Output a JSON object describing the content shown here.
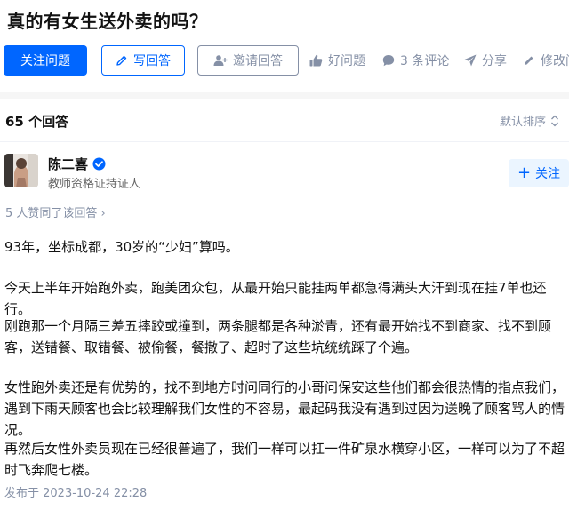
{
  "question": {
    "title": "真的有女生送外卖的吗？"
  },
  "actions": {
    "follow_question": "关注问题",
    "write_answer": "写回答",
    "invite_answer": "邀请回答",
    "good_question": "好问题",
    "comments": "3 条评论",
    "share": "分享",
    "edit": "修改问"
  },
  "answers": {
    "count_label": "65 个回答",
    "sort_label": "默认排序"
  },
  "answer": {
    "author": {
      "name": "陈二喜",
      "bio": "教师资格证持证人",
      "follow_label": "关注"
    },
    "upvote_text": "5 人赞同了该回答",
    "paragraphs": [
      "93年，坐标成都，30岁的“少妇”算吗。",
      "今天上半年开始跑外卖，跑美团众包，从最开始只能挂两单都急得满头大汗到现在挂7单也还行。",
      "刚跑那一个月隔三差五摔跤或撞到，两条腿都是各种淤青，还有最开始找不到商家、找不到顾客，送错餐、取错餐、被偷餐，餐撒了、超时了这些坑统统踩了个遍。",
      "女性跑外卖还是有优势的，找不到地方时问同行的小哥问保安这些他们都会很热情的指点我们，遇到下雨天顾客也会比较理解我们女性的不容易，最起码我没有遇到过因为送晚了顾客骂人的情况。",
      "再然后女性外卖员现在已经很普遍了，我们一样可以扛一件矿泉水横穿小区，一样可以为了不超时飞奔爬七楼。"
    ],
    "published": "发布于 2023-10-24 22:28"
  },
  "colors": {
    "brand_blue": "#0066ff",
    "muted_gray": "#8590a6",
    "follow_bg": "#ebf5ff"
  }
}
